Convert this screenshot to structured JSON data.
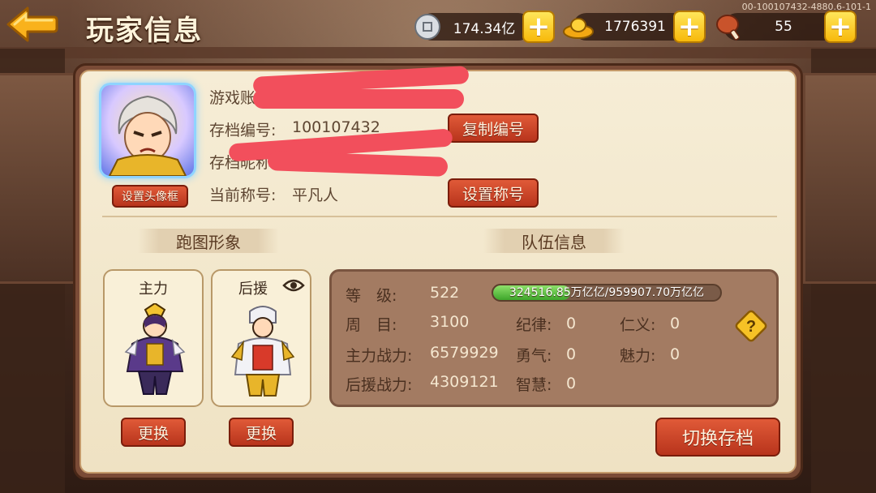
{
  "header": {
    "title": "玩家信息",
    "build_id": "00-100107432-4880.6-101-1"
  },
  "resources": [
    {
      "name": "silver",
      "icon": "silver-coin-icon",
      "value": "174.34亿"
    },
    {
      "name": "gold",
      "icon": "gold-ingot-icon",
      "value": "1776391"
    },
    {
      "name": "stamina",
      "icon": "meat-drumstick-icon",
      "value": "55"
    }
  ],
  "profile": {
    "account_label": "游戏账",
    "save_id_label": "存档编号:",
    "save_id_value": "100107432",
    "nickname_label": "存档昵称:",
    "title_label": "当前称号:",
    "title_value": "平凡人",
    "copy_button": "复制编号",
    "set_title_button": "设置称号",
    "set_frame_button": "设置头像框"
  },
  "appearance": {
    "section_label": "跑图形象",
    "main_label": "主力",
    "support_label": "后援",
    "change_button": "更换"
  },
  "team": {
    "section_label": "队伍信息",
    "level_label": "等　级:",
    "level_value": "522",
    "exp_text": "324516.85万亿亿/959907.70万亿亿",
    "exp_fraction": 0.338,
    "cycle_label": "周　目:",
    "cycle_value": "3100",
    "main_power_label": "主力战力:",
    "main_power_value": "6579929",
    "support_power_label": "后援战力:",
    "support_power_value": "4309121",
    "discipline_label": "纪律:",
    "discipline_value": "0",
    "courage_label": "勇气:",
    "courage_value": "0",
    "wisdom_label": "智慧:",
    "wisdom_value": "0",
    "benevolence_label": "仁义:",
    "benevolence_value": "0",
    "charm_label": "魅力:",
    "charm_value": "0"
  },
  "switch_save_button": "切换存档",
  "colors": {
    "accent_red": "#c8421f",
    "exp_green": "#3ea62b",
    "panel_bg": "#f6edd6"
  }
}
